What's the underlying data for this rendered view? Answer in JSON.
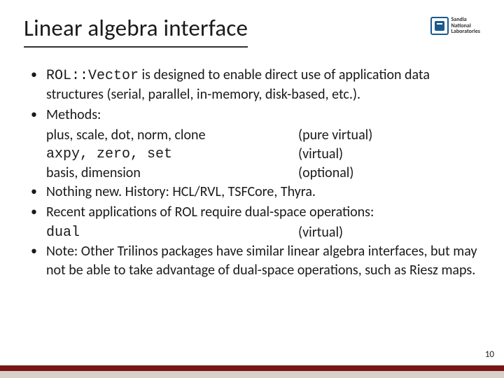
{
  "title": "Linear algebra interface",
  "logo": {
    "line1": "Sandia",
    "line2": "National",
    "line3": "Laboratories"
  },
  "bullets": {
    "b1_code": "ROL::Vector",
    "b1_rest": " is designed to enable direct use of application data structures (serial, parallel, in-memory, disk-based, etc.).",
    "b2": "Methods:",
    "methods": [
      {
        "left": "plus, scale, dot, norm, clone",
        "right": "(pure virtual)"
      },
      {
        "left": "axpy, zero, set",
        "right": "(virtual)"
      },
      {
        "left": "basis, dimension",
        "right": "(optional)"
      }
    ],
    "b3": "Nothing new.  History: HCL/RVL, TSFCore, Thyra.",
    "b4": "Recent applications of ROL require dual-space operations:",
    "dual_left": "dual",
    "dual_right": "(virtual)",
    "b5": "Note:  Other Trilinos packages have similar linear algebra interfaces, but may not be able to take advantage of dual-space operations, such as Riesz maps."
  },
  "page": "10"
}
